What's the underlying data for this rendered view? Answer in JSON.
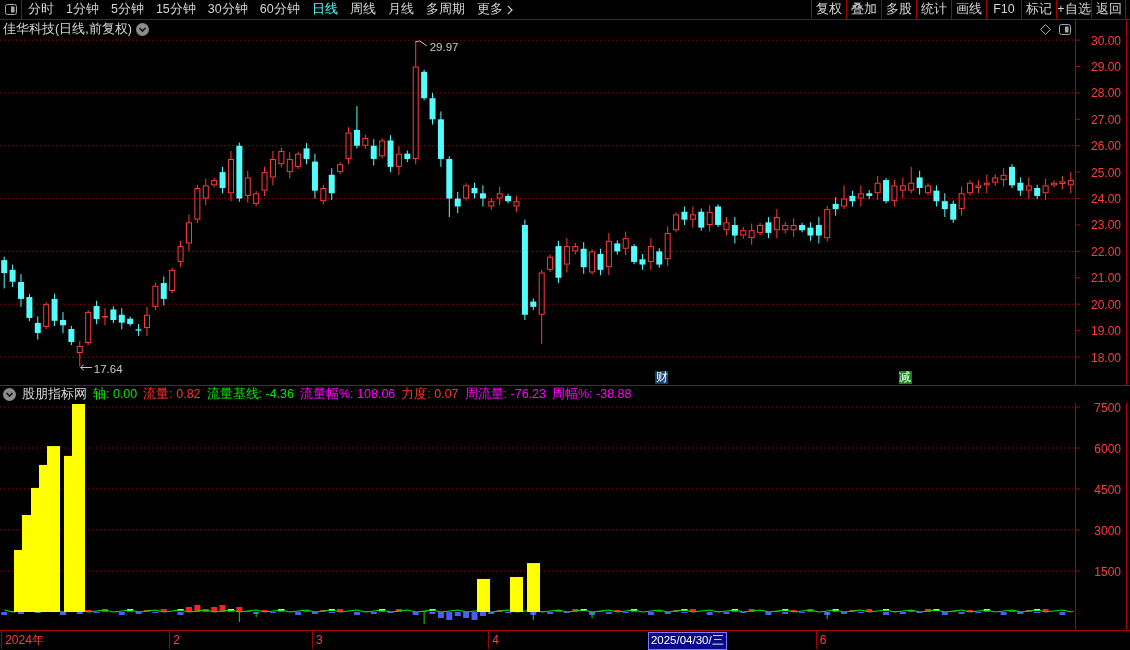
{
  "toolbar": {
    "periods": [
      {
        "label": "分时",
        "selected": false
      },
      {
        "label": "1分钟",
        "selected": false
      },
      {
        "label": "5分钟",
        "selected": false
      },
      {
        "label": "15分钟",
        "selected": false
      },
      {
        "label": "30分钟",
        "selected": false
      },
      {
        "label": "60分钟",
        "selected": false
      },
      {
        "label": "日线",
        "selected": true
      },
      {
        "label": "周线",
        "selected": false
      },
      {
        "label": "月线",
        "selected": false
      },
      {
        "label": "多周期",
        "selected": false
      }
    ],
    "more": "更多",
    "actions": [
      "复权",
      "叠加",
      "多股",
      "统计",
      "画线",
      "F10",
      "标记",
      "+自选",
      "返回"
    ]
  },
  "price_chart": {
    "title": "佳华科技(日线,前复权)",
    "high_label": "29.97",
    "low_label": "17.64",
    "event_markers": [
      {
        "text": "财",
        "color": "#123f78"
      },
      {
        "text": "减",
        "color": "#0e8a0e"
      }
    ],
    "chart_data": {
      "type": "candlestick",
      "grid": true,
      "categories": [
        null,
        null,
        null,
        null,
        null,
        null,
        null,
        null,
        null,
        null,
        null,
        null,
        null,
        null,
        null,
        null,
        null,
        null,
        null,
        null,
        null,
        null,
        null,
        null,
        null,
        null,
        null,
        null,
        null,
        null,
        null,
        null,
        null,
        null,
        null,
        null,
        null,
        null,
        null,
        null,
        null,
        null,
        null,
        null,
        null,
        null,
        null,
        null,
        null,
        null,
        null,
        null,
        null,
        null,
        null,
        null,
        null,
        null,
        null,
        null,
        null,
        null,
        null,
        null,
        null,
        null,
        null,
        null,
        null,
        null,
        null,
        null,
        null,
        null,
        null,
        null,
        null,
        null,
        null,
        null,
        null,
        null,
        null,
        null,
        null,
        null,
        null,
        null,
        null,
        null,
        null,
        null,
        null,
        null,
        null,
        null,
        null,
        null,
        null,
        null,
        null,
        null,
        null,
        null,
        null,
        null,
        null,
        null,
        null,
        null,
        null,
        null,
        null,
        null,
        null,
        null,
        null,
        null,
        null,
        null,
        null,
        null,
        null,
        null,
        null,
        null,
        null,
        null
      ],
      "ohlc": [
        [
          21.67,
          21.8,
          20.6,
          21.18
        ],
        [
          21.3,
          21.5,
          20.65,
          20.85
        ],
        [
          20.84,
          21.14,
          19.9,
          20.2
        ],
        [
          20.27,
          20.39,
          19.36,
          19.48
        ],
        [
          19.29,
          19.54,
          18.66,
          18.91
        ],
        [
          19.14,
          20.08,
          19.06,
          20.0
        ],
        [
          20.2,
          20.4,
          19.17,
          19.37
        ],
        [
          19.4,
          19.7,
          18.9,
          19.2
        ],
        [
          19.06,
          19.18,
          18.45,
          18.57
        ],
        [
          18.15,
          18.6,
          17.64,
          18.42
        ],
        [
          18.53,
          19.78,
          18.45,
          19.7
        ],
        [
          19.93,
          20.13,
          19.24,
          19.44
        ],
        [
          19.5,
          19.85,
          19.2,
          19.55
        ],
        [
          19.8,
          19.92,
          19.28,
          19.4
        ],
        [
          19.6,
          19.85,
          19.05,
          19.3
        ],
        [
          19.45,
          19.53,
          19.17,
          19.25
        ],
        [
          19.05,
          19.25,
          18.8,
          19.0
        ],
        [
          19.1,
          19.9,
          18.8,
          19.6
        ],
        [
          19.9,
          20.82,
          19.78,
          20.7
        ],
        [
          20.8,
          21.05,
          19.95,
          20.2
        ],
        [
          20.5,
          21.38,
          20.42,
          21.3
        ],
        [
          21.6,
          22.4,
          21.4,
          22.2
        ],
        [
          22.3,
          23.4,
          22.0,
          23.1
        ],
        [
          23.2,
          24.52,
          23.08,
          24.4
        ],
        [
          24.0,
          24.75,
          23.75,
          24.5
        ],
        [
          24.5,
          24.78,
          24.42,
          24.7
        ],
        [
          25.0,
          25.2,
          24.2,
          24.4
        ],
        [
          24.2,
          25.8,
          23.9,
          25.5
        ],
        [
          26.0,
          26.12,
          23.88,
          24.0
        ],
        [
          24.1,
          25.05,
          23.85,
          24.8
        ],
        [
          23.8,
          24.28,
          23.72,
          24.2
        ],
        [
          24.3,
          25.2,
          24.1,
          25.0
        ],
        [
          24.8,
          25.8,
          24.5,
          25.5
        ],
        [
          25.3,
          25.92,
          25.18,
          25.8
        ],
        [
          25.0,
          25.75,
          24.75,
          25.5
        ],
        [
          25.2,
          25.78,
          25.12,
          25.7
        ],
        [
          25.9,
          26.1,
          25.3,
          25.5
        ],
        [
          25.4,
          25.7,
          24.0,
          24.3
        ],
        [
          23.9,
          24.52,
          23.78,
          24.4
        ],
        [
          24.9,
          25.15,
          23.95,
          24.2
        ],
        [
          25.0,
          25.38,
          24.92,
          25.3
        ],
        [
          25.5,
          26.7,
          25.3,
          26.5
        ],
        [
          26.6,
          27.5,
          25.9,
          26.0
        ],
        [
          26.0,
          26.42,
          25.88,
          26.3
        ],
        [
          26.0,
          26.25,
          25.25,
          25.5
        ],
        [
          25.6,
          26.28,
          25.52,
          26.2
        ],
        [
          26.2,
          26.4,
          25.0,
          25.2
        ],
        [
          25.2,
          26.0,
          24.9,
          25.7
        ],
        [
          25.7,
          25.82,
          25.38,
          25.5
        ],
        [
          25.5,
          29.97,
          25.3,
          29.0
        ],
        [
          28.8,
          28.88,
          27.72,
          27.8
        ],
        [
          27.8,
          28.0,
          26.8,
          27.0
        ],
        [
          27.0,
          27.3,
          25.2,
          25.5
        ],
        [
          25.5,
          25.6,
          23.3,
          24.0
        ],
        [
          24.0,
          24.25,
          23.45,
          23.7
        ],
        [
          24.0,
          24.58,
          23.92,
          24.5
        ],
        [
          24.4,
          24.6,
          24.0,
          24.2
        ],
        [
          24.2,
          24.5,
          23.7,
          24.0
        ],
        [
          23.7,
          24.02,
          23.58,
          23.9
        ],
        [
          24.0,
          24.45,
          23.75,
          24.2
        ],
        [
          24.1,
          24.18,
          23.82,
          23.9
        ],
        [
          23.7,
          24.1,
          23.5,
          23.9
        ],
        [
          23.0,
          23.2,
          19.4,
          19.6
        ],
        [
          20.1,
          20.22,
          19.78,
          19.9
        ],
        [
          19.6,
          21.3,
          18.5,
          21.2
        ],
        [
          21.3,
          21.88,
          21.22,
          21.8
        ],
        [
          22.2,
          22.4,
          20.8,
          21.0
        ],
        [
          21.5,
          22.5,
          21.2,
          22.2
        ],
        [
          22.0,
          22.32,
          21.88,
          22.2
        ],
        [
          22.1,
          22.35,
          21.15,
          21.4
        ],
        [
          21.2,
          22.08,
          21.12,
          22.0
        ],
        [
          21.9,
          22.1,
          21.1,
          21.3
        ],
        [
          21.4,
          22.7,
          21.1,
          22.4
        ],
        [
          22.3,
          22.42,
          21.88,
          22.0
        ],
        [
          22.1,
          22.75,
          21.85,
          22.5
        ],
        [
          22.2,
          22.28,
          21.52,
          21.6
        ],
        [
          21.7,
          21.9,
          21.3,
          21.5
        ],
        [
          21.6,
          22.5,
          21.3,
          22.2
        ],
        [
          22.0,
          22.12,
          21.38,
          21.5
        ],
        [
          21.7,
          22.95,
          21.45,
          22.7
        ],
        [
          22.8,
          23.48,
          22.72,
          23.4
        ],
        [
          23.5,
          23.7,
          23.0,
          23.2
        ],
        [
          23.2,
          23.7,
          22.9,
          23.4
        ],
        [
          23.5,
          23.62,
          22.78,
          22.9
        ],
        [
          23.0,
          23.75,
          22.75,
          23.5
        ],
        [
          23.7,
          23.78,
          22.92,
          23.0
        ],
        [
          22.8,
          23.3,
          22.6,
          23.1
        ],
        [
          23.0,
          23.3,
          22.3,
          22.6
        ],
        [
          22.6,
          22.92,
          22.48,
          22.8
        ],
        [
          22.5,
          23.05,
          22.25,
          22.8
        ],
        [
          22.7,
          23.08,
          22.62,
          23.0
        ],
        [
          23.1,
          23.3,
          22.5,
          22.7
        ],
        [
          22.8,
          23.6,
          22.5,
          23.3
        ],
        [
          22.8,
          23.12,
          22.68,
          23.0
        ],
        [
          22.8,
          23.25,
          22.55,
          23.0
        ],
        [
          23.0,
          23.08,
          22.72,
          22.8
        ],
        [
          22.9,
          23.1,
          22.4,
          22.6
        ],
        [
          23.0,
          23.3,
          22.3,
          22.6
        ],
        [
          22.5,
          23.72,
          22.38,
          23.6
        ],
        [
          23.8,
          24.05,
          23.35,
          23.6
        ],
        [
          23.7,
          24.5,
          23.6,
          24.0
        ],
        [
          24.1,
          24.3,
          23.7,
          23.9
        ],
        [
          24.0,
          24.5,
          23.7,
          24.2
        ],
        [
          24.2,
          24.32,
          23.98,
          24.1
        ],
        [
          24.2,
          24.85,
          23.95,
          24.6
        ],
        [
          24.7,
          24.78,
          23.82,
          23.9
        ],
        [
          23.9,
          24.7,
          23.7,
          24.5
        ],
        [
          24.3,
          24.8,
          24.0,
          24.5
        ],
        [
          24.3,
          25.2,
          24.2,
          24.6
        ],
        [
          24.8,
          25.05,
          24.15,
          24.4
        ],
        [
          24.2,
          24.58,
          24.12,
          24.5
        ],
        [
          24.3,
          24.5,
          23.7,
          23.9
        ],
        [
          23.9,
          24.2,
          23.3,
          23.6
        ],
        [
          23.8,
          23.92,
          23.08,
          23.2
        ],
        [
          23.6,
          24.45,
          23.35,
          24.2
        ],
        [
          24.2,
          24.68,
          24.12,
          24.6
        ],
        [
          24.4,
          24.7,
          24.2,
          24.5
        ],
        [
          24.5,
          24.9,
          24.2,
          24.6
        ],
        [
          24.6,
          24.92,
          24.48,
          24.8
        ],
        [
          24.7,
          25.15,
          24.45,
          24.9
        ],
        [
          25.2,
          25.3,
          24.4,
          24.5
        ],
        [
          24.6,
          24.8,
          24.1,
          24.3
        ],
        [
          24.3,
          24.8,
          24.0,
          24.5
        ],
        [
          24.4,
          24.52,
          23.98,
          24.1
        ],
        [
          24.2,
          24.75,
          23.95,
          24.5
        ],
        [
          24.5,
          24.68,
          24.42,
          24.6
        ],
        [
          24.55,
          24.85,
          24.35,
          24.65
        ],
        [
          24.5,
          25.0,
          24.2,
          24.7
        ]
      ],
      "ylim": [
        16.94,
        30.08
      ],
      "yticks": [
        {
          "value": 30,
          "label": "30.00"
        },
        {
          "value": 29,
          "label": "29.00"
        },
        {
          "value": 28,
          "label": "28.00"
        },
        {
          "value": 27,
          "label": "27.00"
        },
        {
          "value": 26,
          "label": "26.00"
        },
        {
          "value": 25,
          "label": "25.00"
        },
        {
          "value": 24,
          "label": "24.00"
        },
        {
          "value": 23,
          "label": "23.00"
        },
        {
          "value": 22,
          "label": "22.00"
        },
        {
          "value": 21,
          "label": "21.00"
        },
        {
          "value": 20,
          "label": "20.00"
        },
        {
          "value": 19,
          "label": "19.00"
        },
        {
          "value": 18,
          "label": "18.00"
        }
      ]
    }
  },
  "indicator": {
    "name": "股朋指标网",
    "values": [
      {
        "text": "轴: 0.00",
        "color": "#00e600"
      },
      {
        "text": "流量: 0.82",
        "color": "#ff3232"
      },
      {
        "text": "流量基线: -4.36",
        "color": "#00e600"
      },
      {
        "text": "流量幅%: 108.06",
        "color": "#ff00ff"
      },
      {
        "text": "力度: 0.07",
        "color": "#ff3232"
      },
      {
        "text": "周流量: -76.23",
        "color": "#ff00ff"
      },
      {
        "text": "周幅%: -38.88",
        "color": "#ff00ff"
      }
    ],
    "axis_labels": [
      "7500",
      "6000",
      "4500",
      "3000",
      "1500"
    ]
  },
  "date_axis": {
    "labels": [
      {
        "text": "2024年",
        "kind": "month"
      },
      {
        "text": "2",
        "kind": "month"
      },
      {
        "text": "3",
        "kind": "month"
      },
      {
        "text": "4",
        "kind": "month"
      },
      {
        "text": "2025/04/30/三",
        "kind": "cursor"
      },
      {
        "text": "6",
        "kind": "month"
      }
    ]
  }
}
